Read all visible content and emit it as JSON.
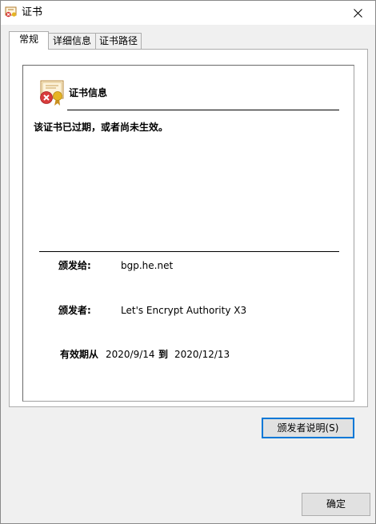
{
  "window": {
    "title": "证书"
  },
  "tabs": [
    {
      "label": "常规",
      "active": true
    },
    {
      "label": "详细信息",
      "active": false
    },
    {
      "label": "证书路径",
      "active": false
    }
  ],
  "general": {
    "section_title": "证书信息",
    "status": "该证书已过期，或者尚未生效。",
    "issued_to_label": "颁发给:",
    "issued_to_value": "bgp.he.net",
    "issued_by_label": "颁发者:",
    "issued_by_value": "Let's Encrypt Authority X3",
    "valid_from_label": "有效期从",
    "valid_from_value": "2020/9/14",
    "valid_to_label": "到",
    "valid_to_value": "2020/12/13"
  },
  "buttons": {
    "issuer_statement": "颁发者说明(S)",
    "ok": "确定"
  },
  "icons": {
    "title": "certificate-icon",
    "section": "certificate-error-icon",
    "close": "close-icon"
  },
  "colors": {
    "accent": "#0078d7",
    "error_red": "#d83b3b",
    "seal_gold": "#e6b422"
  }
}
